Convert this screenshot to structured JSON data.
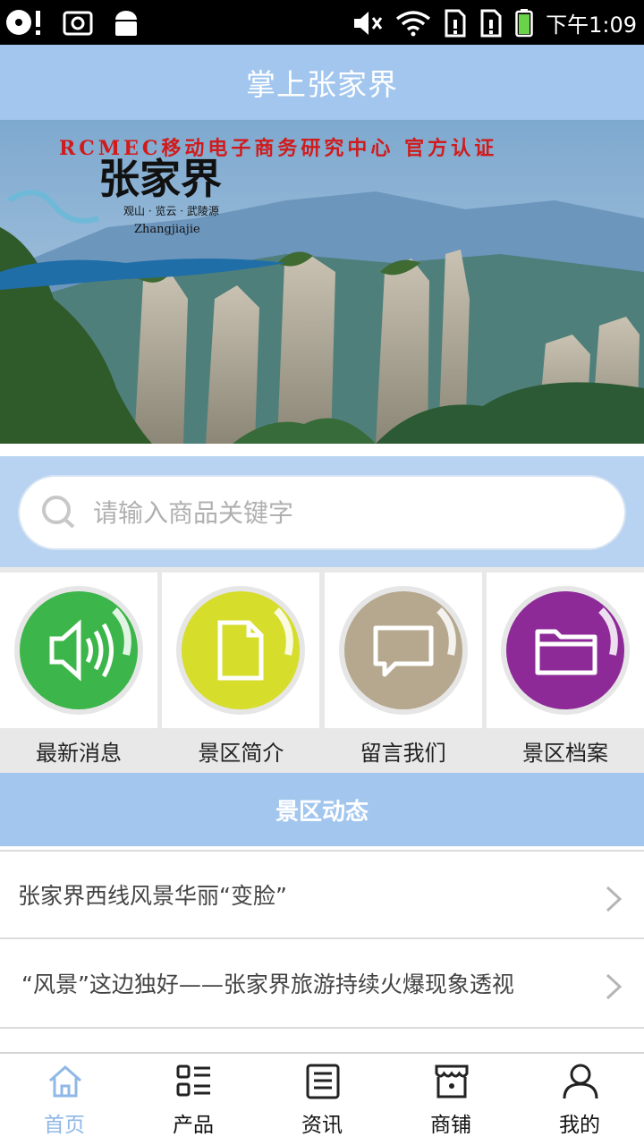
{
  "status_bar": {
    "time": "下午1:09"
  },
  "app": {
    "title": "掌上张家界"
  },
  "banner": {
    "caption": "RCMEC移动电子商务研究中心  官方认证",
    "logo_text": "张家界",
    "logo_sub": "观山 · 览云 · 武陵源",
    "logo_en": "Zhangjiajie"
  },
  "search": {
    "placeholder": "请输入商品关键字"
  },
  "grid": [
    {
      "label": "最新消息",
      "color": "#3cb54a",
      "icon": "speaker-icon"
    },
    {
      "label": "景区简介",
      "color": "#d6dd2a",
      "icon": "document-icon"
    },
    {
      "label": "留言我们",
      "color": "#b5a88e",
      "icon": "message-icon"
    },
    {
      "label": "景区档案",
      "color": "#8d2a98",
      "icon": "folder-icon"
    }
  ],
  "section": {
    "title": "景区动态"
  },
  "news": [
    {
      "title": "张家界西线风景华丽“变脸”"
    },
    {
      "title": "“风景”这边独好——张家界旅游持续火爆现象透视"
    }
  ],
  "nav": [
    {
      "label": "首页",
      "icon": "home-icon",
      "active": true
    },
    {
      "label": "产品",
      "icon": "list-icon"
    },
    {
      "label": "资讯",
      "icon": "news-icon"
    },
    {
      "label": "商铺",
      "icon": "store-icon"
    },
    {
      "label": "我的",
      "icon": "user-icon"
    }
  ],
  "colors": {
    "accent": "#a2c6ee",
    "search_band": "#b8d3f1",
    "nav_active": "#8fb8e6"
  }
}
